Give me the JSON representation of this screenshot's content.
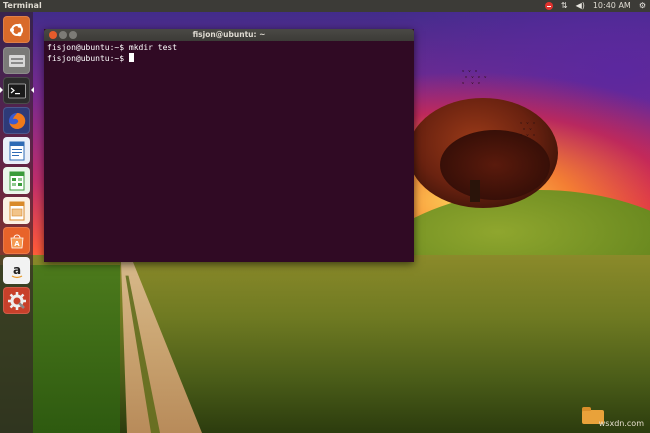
{
  "panel": {
    "app_title": "Terminal",
    "clock": "10:40 AM",
    "indicators": [
      "error-icon",
      "network-arrows-icon",
      "sound-icon",
      "power-icon"
    ]
  },
  "launcher": {
    "items": [
      {
        "name": "ubuntu-dash",
        "icon": "ubuntu-logo-icon",
        "color": "#e0732c"
      },
      {
        "name": "files",
        "icon": "file-manager-icon",
        "color": "#8a8a8a"
      },
      {
        "name": "terminal",
        "icon": "terminal-icon",
        "color": "#3a3a3a",
        "running": true
      },
      {
        "name": "firefox",
        "icon": "firefox-icon",
        "color": "#e66c1f"
      },
      {
        "name": "libreoffice-writer",
        "icon": "writer-icon",
        "color": "#2e6bb5"
      },
      {
        "name": "libreoffice-calc",
        "icon": "calc-icon",
        "color": "#3a9b3a"
      },
      {
        "name": "libreoffice-impress",
        "icon": "impress-icon",
        "color": "#d98a2a"
      },
      {
        "name": "ubuntu-software",
        "icon": "software-center-icon",
        "color": "#e86a2a"
      },
      {
        "name": "amazon",
        "icon": "amazon-icon",
        "color": "#e8e8e8"
      },
      {
        "name": "system-settings",
        "icon": "settings-gear-icon",
        "color": "#c8402a"
      }
    ]
  },
  "terminal": {
    "title": "fisjon@ubuntu: ~",
    "lines": [
      "fisjon@ubuntu:~$ mkdir test",
      "fisjon@ubuntu:~$ "
    ]
  },
  "watermark": "wsxdn.com"
}
